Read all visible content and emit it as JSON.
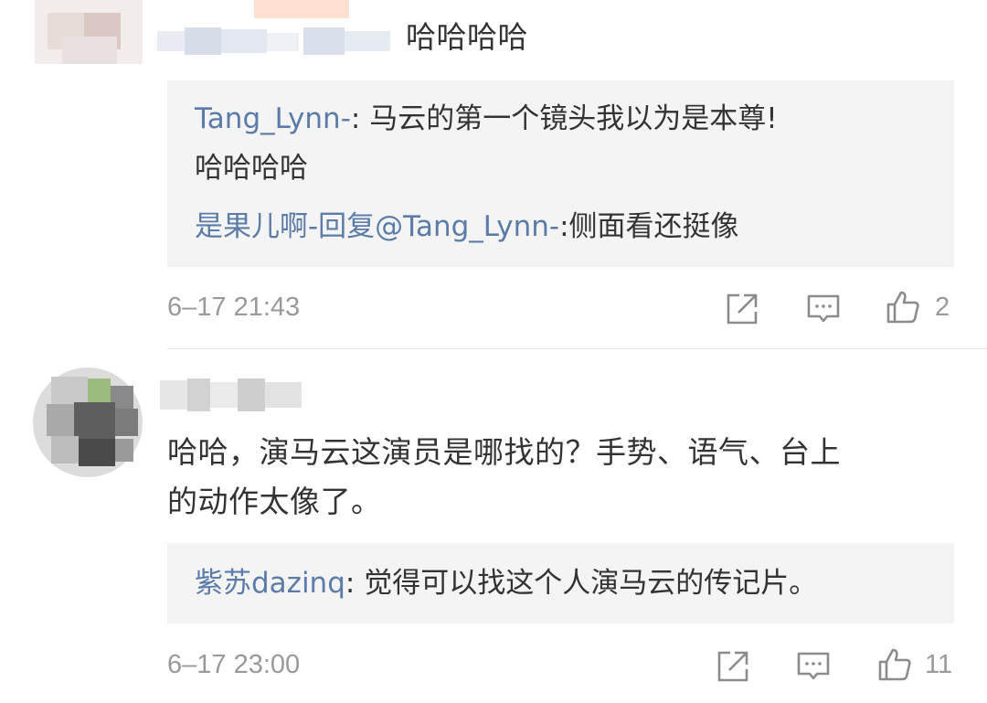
{
  "comments": [
    {
      "text": "哈哈哈哈",
      "replies": [
        {
          "user": "Tang_Lynn-",
          "sep": ": ",
          "text_line1": "马云的第一个镜头我以为是本尊!",
          "text_line2": "哈哈哈哈"
        },
        {
          "user": "是果儿啊-回复@Tang_Lynn-",
          "sep": ":",
          "text_line1": "侧面看还挺像"
        }
      ],
      "timestamp": "6–17 21:43",
      "likes": "2"
    },
    {
      "text_line1": "哈哈，演马云这演员是哪找的？手势、语气、台上",
      "text_line2": "的动作太像了。",
      "replies": [
        {
          "user": "紫苏dazinq",
          "sep": ": ",
          "text_line1": "觉得可以找这个人演马云的传记片。"
        }
      ],
      "timestamp": "6–17 23:00",
      "likes": "11"
    }
  ],
  "icons": {
    "share": "share-icon",
    "comment": "comment-icon",
    "like": "thumbs-up-icon"
  },
  "colors": {
    "username": "#5b7ca8",
    "meta": "#999999",
    "reply_bg": "#f4f4f4",
    "text": "#333333"
  }
}
